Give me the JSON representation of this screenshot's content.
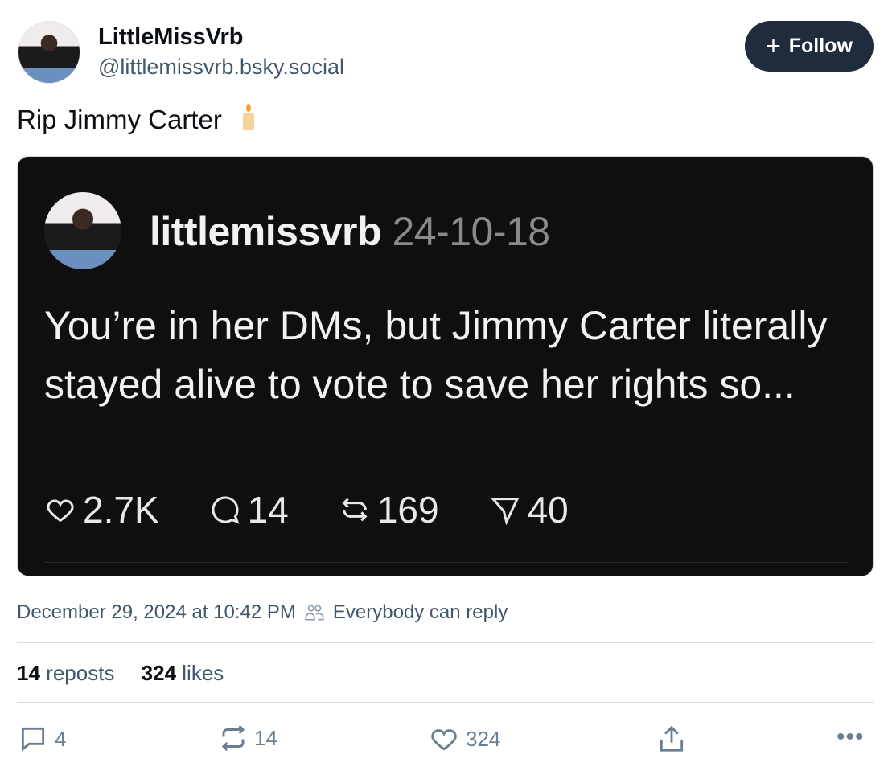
{
  "author": {
    "name": "LittleMissVrb",
    "handle": "@littlemissvrb.bsky.social"
  },
  "follow_label": "Follow",
  "post_text": "Rip Jimmy Carter",
  "embed": {
    "username": "littlemissvrb",
    "date": "24-10-18",
    "body": "You’re in her DMs, but Jimmy Carter literally stayed alive to vote to save her rights so...",
    "likes": "2.7K",
    "comments": "14",
    "reposts": "169",
    "shares": "40"
  },
  "meta": {
    "timestamp": "December 29, 2024 at 10:42 PM",
    "reply_setting": "Everybody can reply"
  },
  "counts": {
    "reposts_num": "14",
    "reposts_label": "reposts",
    "likes_num": "324",
    "likes_label": "likes"
  },
  "actions": {
    "replies": "4",
    "reposts": "14",
    "likes": "324"
  },
  "colors": {
    "follow_bg": "#1f2c3b",
    "muted": "#42576c",
    "embed_bg": "#0f0f0f"
  }
}
